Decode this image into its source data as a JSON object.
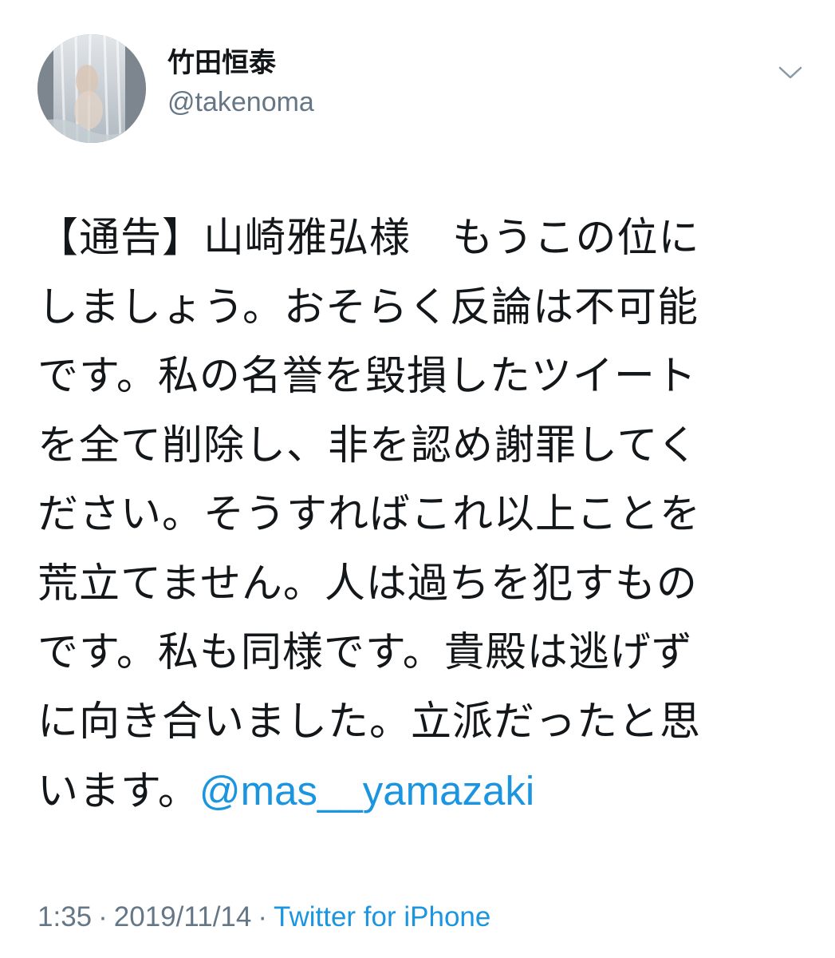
{
  "user": {
    "display_name": "竹田恒泰",
    "handle": "@takenoma"
  },
  "tweet": {
    "lines": [
      "【通告】山崎雅弘様　もうこの位に",
      "しましょう。おそらく反論は不可能",
      "です。私の名誉を毀損したツイート",
      "を全て削除し、非を認め謝罪してく",
      "ださい。そうすればこれ以上ことを",
      "荒立てません。人は過ちを犯すもの",
      "です。私も同様です。貴殿は逃げず",
      "に向き合いました。立派だったと思"
    ],
    "last_line_text": "います。",
    "mention": "@mas__yamazaki"
  },
  "meta": {
    "time": "1:35",
    "separator": "·",
    "date": "2019/11/14",
    "source": "Twitter for iPhone"
  },
  "icons": {
    "menu": "chevron-down-icon",
    "avatar": "profile-photo"
  },
  "colors": {
    "text": "#14171a",
    "secondary": "#657786",
    "link": "#1b95e0"
  }
}
